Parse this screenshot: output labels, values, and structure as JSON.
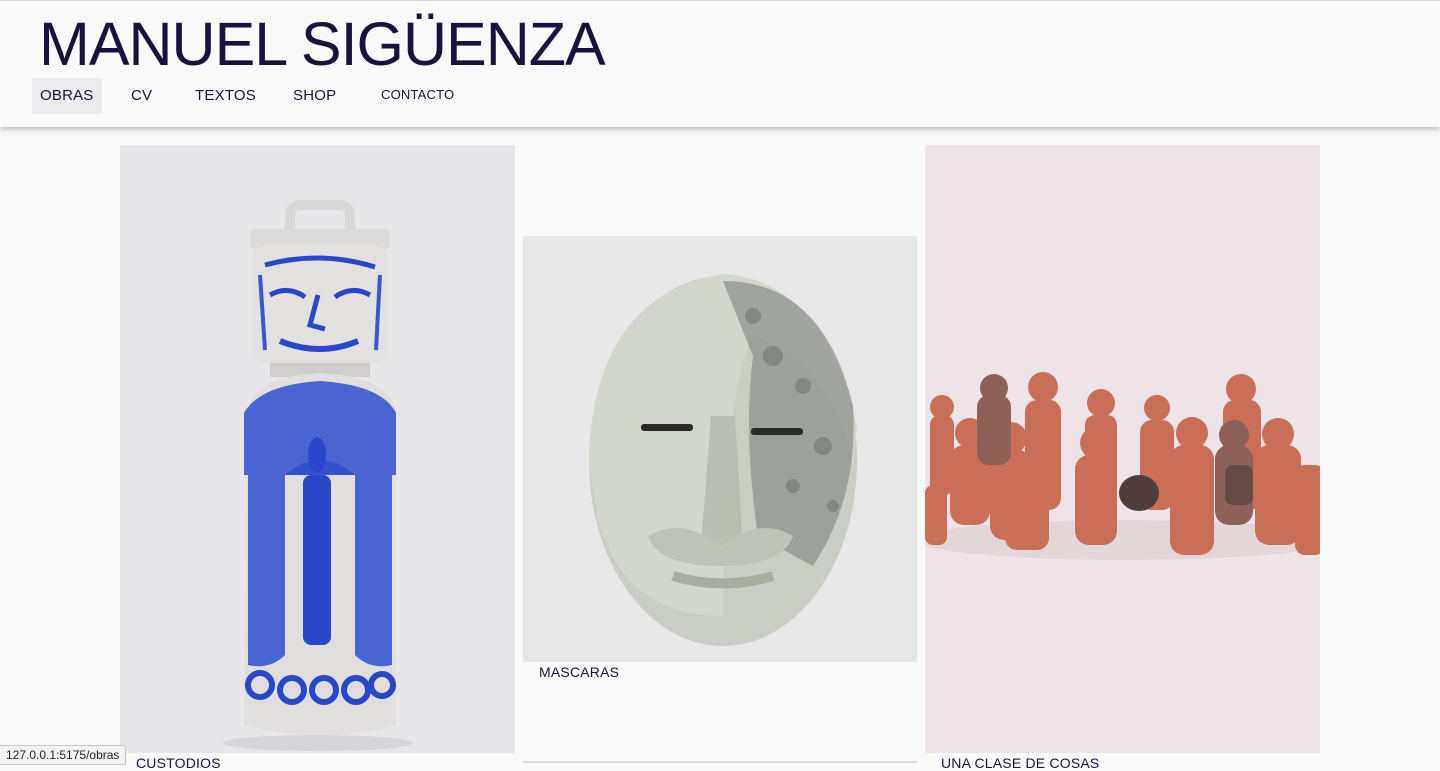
{
  "site": {
    "title": "MANUEL SIGÜENZA"
  },
  "nav": {
    "items": [
      {
        "label": "OBRAS",
        "active": true
      },
      {
        "label": "CV"
      },
      {
        "label": "TEXTOS"
      },
      {
        "label": "SHOP"
      },
      {
        "label": "CONTACTO"
      }
    ]
  },
  "gallery": {
    "works": [
      {
        "caption": "CUSTODIOS",
        "subject": "blue and white ceramic vessel with lid"
      },
      {
        "caption": "MASCARAS",
        "subject": "green ceramic mask"
      },
      {
        "caption": "UNA CLASE DE COSAS",
        "subject": "group of terracotta figurines"
      }
    ]
  },
  "status_bar": {
    "url": "127.0.0.1:5175/obras"
  }
}
